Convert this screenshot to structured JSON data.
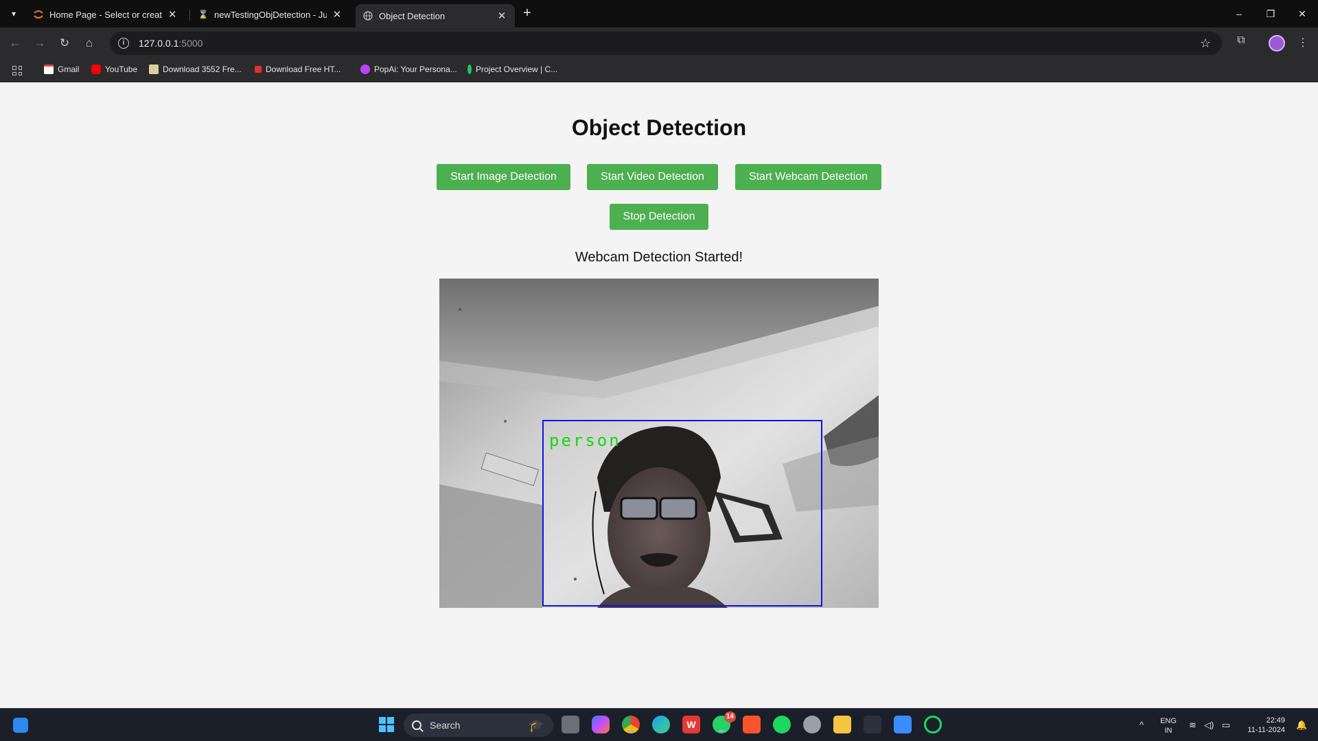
{
  "browser": {
    "tabs": [
      {
        "title": "Home Page - Select or create a",
        "favicon": "jupyter-icon",
        "active": false
      },
      {
        "title": "newTestingObjDetection - Jupy",
        "favicon": "hourglass-icon",
        "active": false
      },
      {
        "title": "Object Detection",
        "favicon": "globe-icon",
        "active": true
      }
    ],
    "url_host": "127.0.0.1",
    "url_port": ":5000",
    "bookmarks": [
      {
        "label": "Gmail",
        "color": "#ea4335"
      },
      {
        "label": "YouTube",
        "color": "#ff0000"
      },
      {
        "label": "Download 3552 Fre...",
        "color": "#d9cfa0"
      },
      {
        "label": "Download Free HT...",
        "color": "#e03131"
      },
      {
        "label": "PopAi: Your Persona...",
        "color": "#c040ff"
      },
      {
        "label": "Project Overview | C...",
        "color": "#22c55e"
      }
    ]
  },
  "page": {
    "title": "Object Detection",
    "buttons": {
      "image": "Start Image Detection",
      "video": "Start Video Detection",
      "webcam": "Start Webcam Detection",
      "stop": "Stop Detection"
    },
    "status": "Webcam Detection Started!",
    "detection": {
      "label": "person",
      "box_color": "#1010e6",
      "label_color": "#12d612"
    },
    "accent_color": "#4caf50"
  },
  "taskbar": {
    "search_placeholder": "Search",
    "whatsapp_badge": "14",
    "language_line1": "ENG",
    "language_line2": "IN",
    "time": "22:49",
    "date": "11-11-2024"
  }
}
